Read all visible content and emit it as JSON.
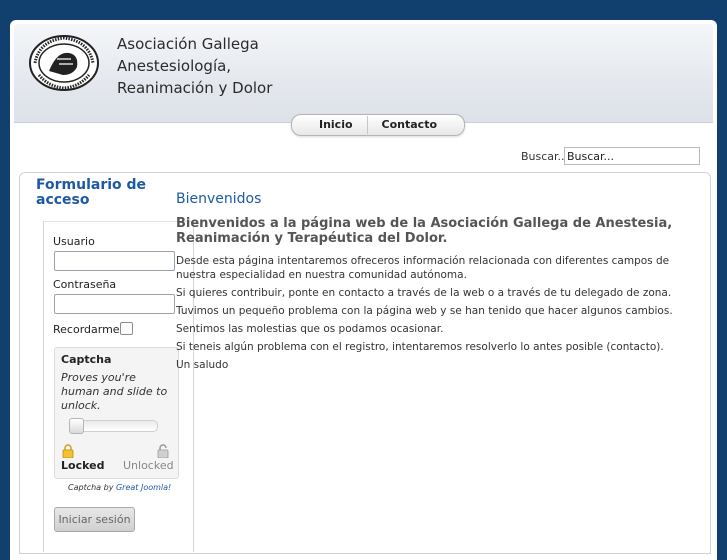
{
  "site": {
    "title_lines": [
      "Asociación Gallega",
      "Anestesiología,",
      "Reanimación y Dolor"
    ],
    "logo_text": "ASOCIACIÓN GALLEGA DE ANESTESIOLOGÍA, REANIMACIÓN Y DOLOR"
  },
  "nav": {
    "items": [
      {
        "label": "Inicio"
      },
      {
        "label": "Contacto"
      }
    ]
  },
  "search": {
    "label": "Buscar...",
    "value": "Buscar..."
  },
  "login": {
    "title": "Formulario de acceso",
    "username_label": "Usuario",
    "password_label": "Contraseña",
    "remember_label": "Recordarme",
    "submit_label": "Iniciar sesión",
    "captcha": {
      "title": "Captcha",
      "hint": "Proves you're human and slide to unlock.",
      "locked_label": "Locked",
      "unlocked_label": "Unlocked",
      "credit_prefix": "Captcha by",
      "credit_link": "Great Joomla!"
    }
  },
  "main": {
    "heading": "Bienvenidos",
    "title": "Bienvenidos a la página web de la Asociación Gallega de Anestesia, Reanimación y Terapéutica del Dolor.",
    "paragraphs": [
      "Desde esta página intentaremos ofreceros información relacionada con diferentes campos de nuestra especialidad en nuestra comunidad autónoma.",
      "Si quieres contribuir, ponte en contacto a través de la web o a través de tu delegado de zona.",
      "Tuvimos un pequeño problema con la página web y se han tenido que hacer algunos cambios.",
      "Sentimos las molestias que os podamos ocasionar.",
      "Si teneis algún problema con el registro, intentaremos resolverlo lo antes posible (contacto).",
      "Un saludo"
    ]
  }
}
